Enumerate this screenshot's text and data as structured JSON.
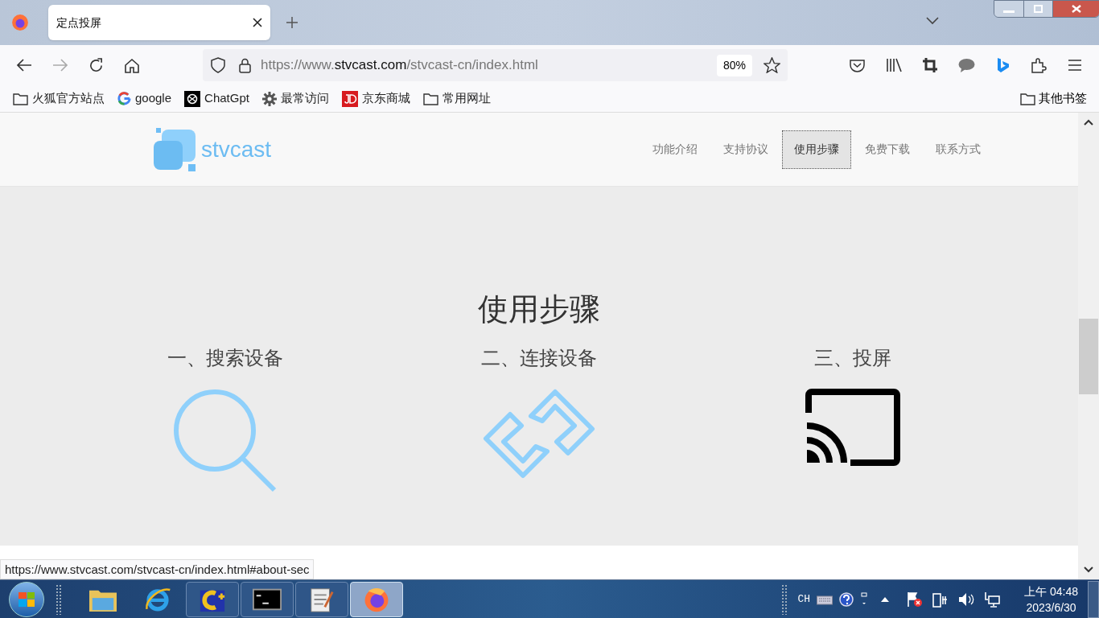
{
  "tab": {
    "title": "定点投屏"
  },
  "address_bar": {
    "prefix": "https://www.",
    "domain": "stvcast.com",
    "path": "/stvcast-cn/index.html",
    "zoom": "80%"
  },
  "bookmarks": [
    {
      "kind": "folder",
      "label": "火狐官方站点"
    },
    {
      "kind": "google",
      "label": "google"
    },
    {
      "kind": "chatgpt",
      "label": "ChatGpt"
    },
    {
      "kind": "gear",
      "label": "最常访问"
    },
    {
      "kind": "jd",
      "label": "京东商城"
    },
    {
      "kind": "folder",
      "label": "常用网址"
    }
  ],
  "other_bookmarks": "其他书签",
  "site": {
    "logo": "stvcast",
    "nav": [
      {
        "label": "功能介绍",
        "selected": false
      },
      {
        "label": "支持协议",
        "selected": false
      },
      {
        "label": "使用步骤",
        "selected": true
      },
      {
        "label": "免费下载",
        "selected": false
      },
      {
        "label": "联系方式",
        "selected": false
      }
    ],
    "section_title": "使用步骤",
    "steps": [
      {
        "label": "一、搜索设备",
        "kind": "search"
      },
      {
        "label": "二、连接设备",
        "kind": "link"
      },
      {
        "label": "三、投屏",
        "kind": "cast"
      }
    ]
  },
  "status_link": "https://www.stvcast.com/stvcast-cn/index.html#about-sec",
  "taskbar": {
    "apps": [
      {
        "kind": "folder",
        "selected": false
      },
      {
        "kind": "ie",
        "selected": false
      },
      {
        "kind": "cpp",
        "selected": false
      },
      {
        "kind": "cmd",
        "selected": false
      },
      {
        "kind": "notes",
        "selected": false
      },
      {
        "kind": "firefox",
        "selected": true
      }
    ],
    "language": "CH",
    "time": "上午 04:48",
    "date": "2023/6/30"
  }
}
